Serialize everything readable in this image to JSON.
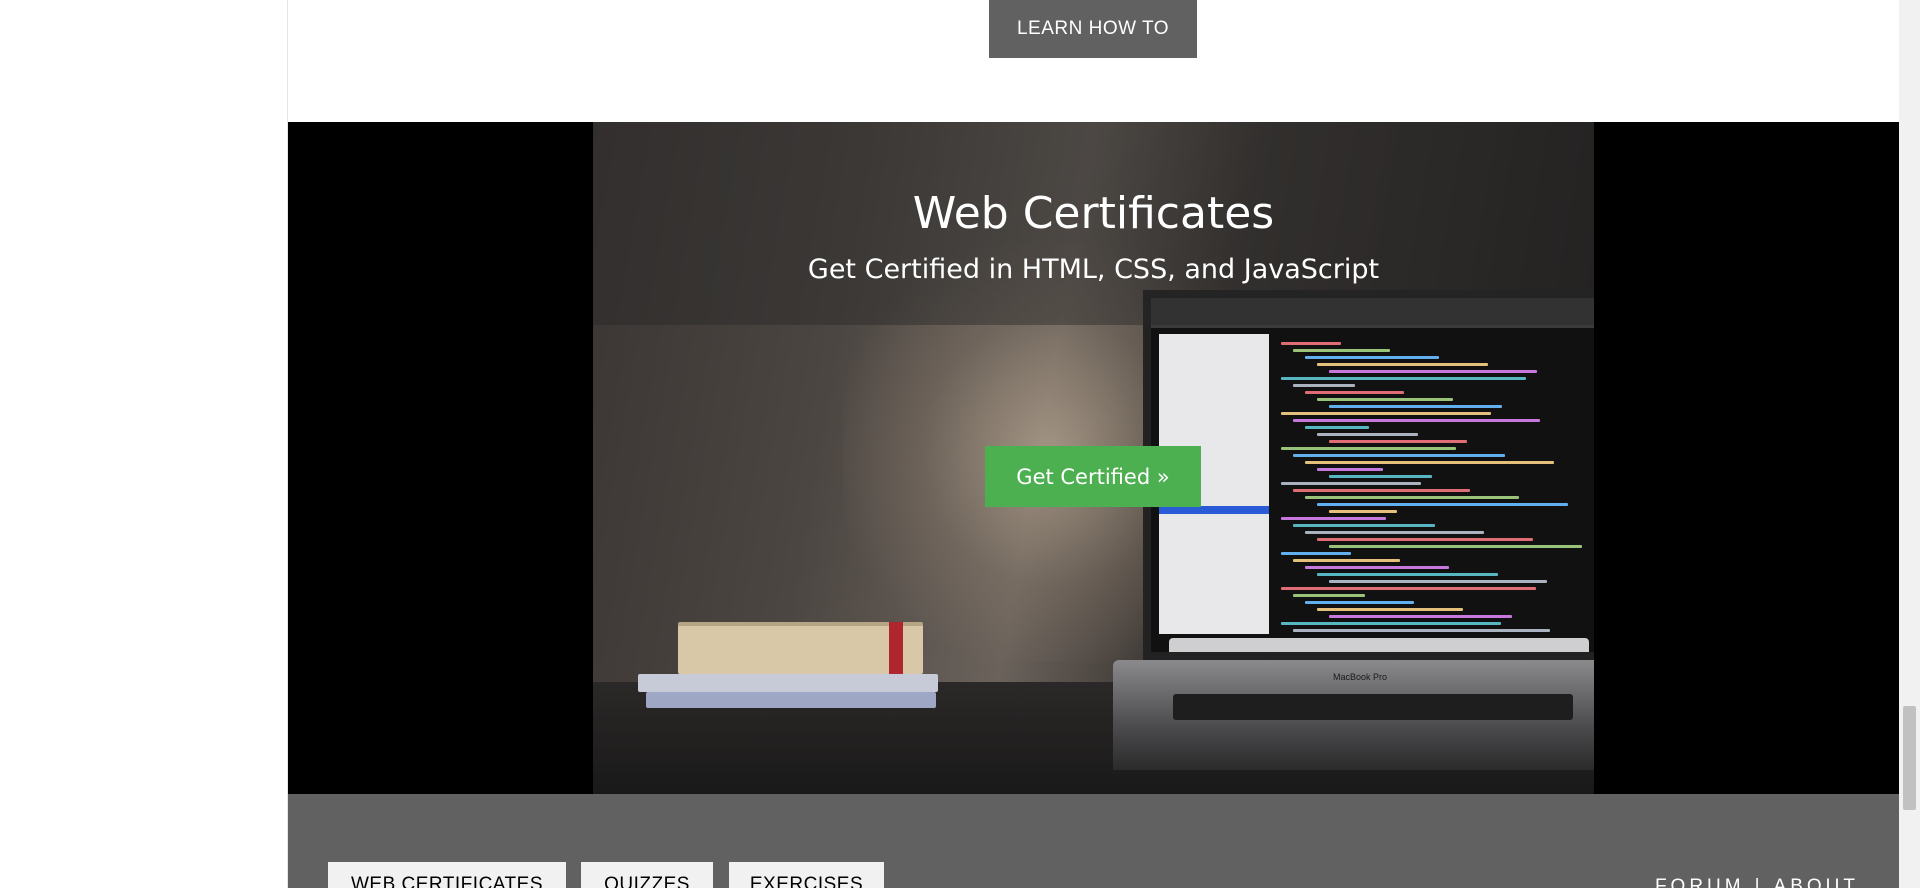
{
  "top_section": {
    "learn_button_label": "LEARN HOW TO"
  },
  "hero": {
    "title": "Web Certificates",
    "subtitle": "Get Certified in HTML, CSS, and JavaScript",
    "cta_label": "Get Certified »",
    "laptop_label": "MacBook Pro"
  },
  "footer": {
    "buttons": [
      {
        "label": "WEB CERTIFICATES"
      },
      {
        "label": "QUIZZES"
      },
      {
        "label": "EXERCISES"
      }
    ],
    "links": [
      {
        "label": "FORUM"
      },
      {
        "label": "ABOUT"
      }
    ],
    "separator": "|"
  },
  "colors": {
    "button_gray": "#616161",
    "cta_green": "#4caf50",
    "footer_bg": "#616161",
    "hero_bg": "#000000"
  }
}
